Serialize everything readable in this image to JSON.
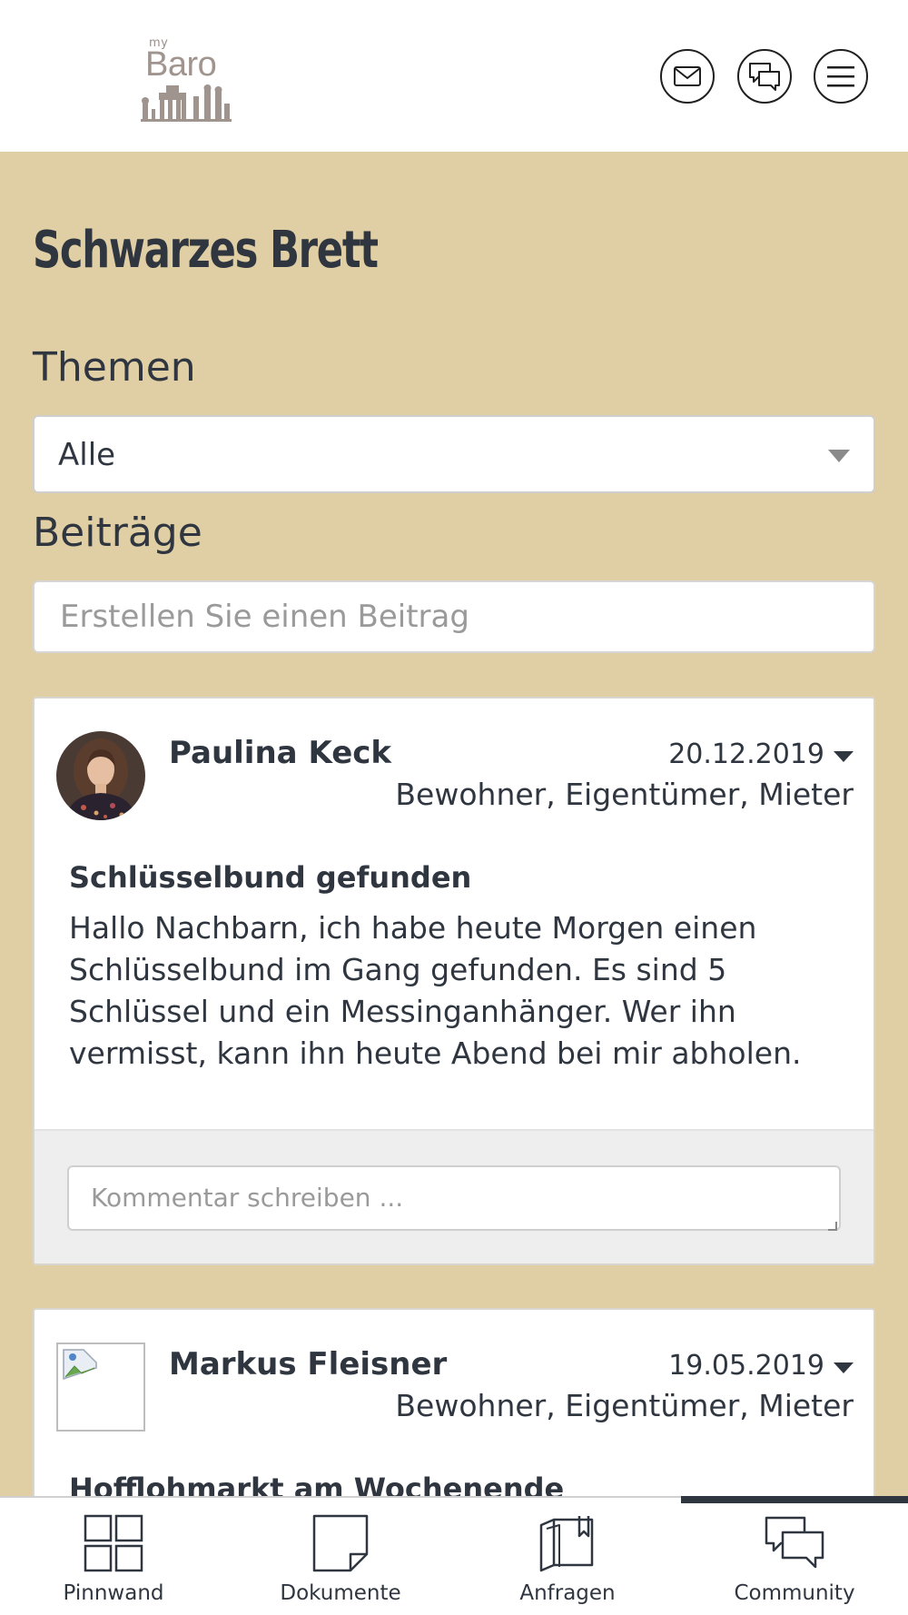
{
  "header": {
    "logo_small": "my",
    "logo_main": "Baro",
    "buttons": [
      {
        "icon": "mail-icon"
      },
      {
        "icon": "chat-icon"
      },
      {
        "icon": "menu-icon"
      }
    ]
  },
  "page": {
    "title": "Schwarzes Brett",
    "themes_label": "Themen",
    "themes_selected": "Alle",
    "posts_label": "Beiträge",
    "create_post_placeholder": "Erstellen Sie einen Beitrag"
  },
  "posts": [
    {
      "author": "Paulina Keck",
      "date": "20.12.2019",
      "roles": "Bewohner, Eigentümer, Mieter",
      "title": "Schlüsselbund gefunden",
      "body": "Hallo Nachbarn, ich habe heute Morgen einen Schlüsselbund im Gang gefunden. Es sind 5 Schlüssel und ein Messinganhänger. Wer ihn vermisst, kann ihn heute Abend bei mir abholen.",
      "comment_placeholder": "Kommentar schreiben ..."
    },
    {
      "author": "Markus Fleisner",
      "date": "19.05.2019",
      "roles": "Bewohner, Eigentümer, Mieter",
      "title": "Hofflohmarkt am Wochenende"
    }
  ],
  "nav": {
    "items": [
      {
        "label": "Pinnwand",
        "icon": "grid-icon"
      },
      {
        "label": "Dokumente",
        "icon": "document-icon"
      },
      {
        "label": "Anfragen",
        "icon": "folder-icon"
      },
      {
        "label": "Community",
        "icon": "community-icon"
      }
    ],
    "active_index": 3
  },
  "colors": {
    "beige_background": "#e0cfa4",
    "text_dark": "#2f3640",
    "logo_taupe": "#a0948f"
  }
}
